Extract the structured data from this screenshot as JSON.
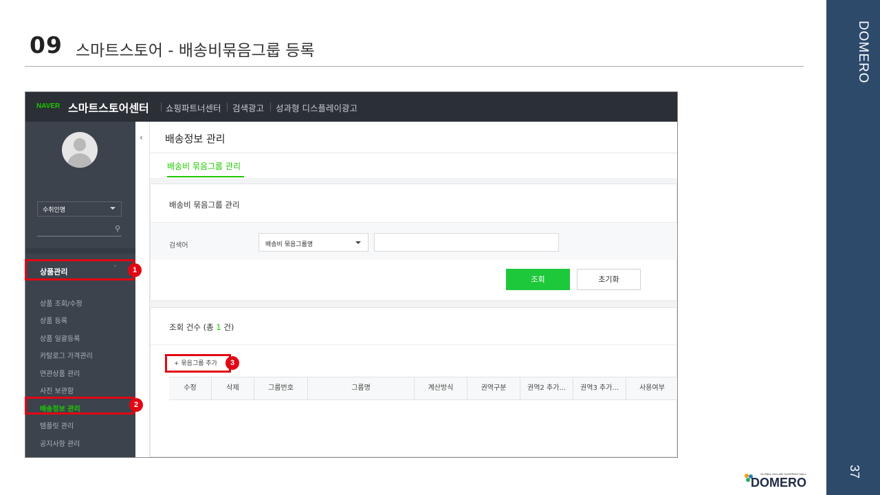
{
  "slide": {
    "number": "09",
    "title": "스마트스토어 - 배송비묶음그룹 등록",
    "brand_vertical": "DOMERO",
    "page_number": "37",
    "logo_small": "GLOBAL ON-LINE SHOPPING MALL",
    "logo_text": "DOMERO"
  },
  "app": {
    "naver": "NAVER",
    "center_name": "스마트스토어센터",
    "top_nav": [
      "쇼핑파트너센터",
      "검색광고",
      "성과형 디스플레이광고"
    ]
  },
  "sidebar": {
    "seller_select": "수취인명",
    "group_label": "상품관리",
    "items": [
      {
        "label": "상품 조회/수정"
      },
      {
        "label": "상품 등록"
      },
      {
        "label": "상품 일괄등록"
      },
      {
        "label": "카탈로그 가격관리"
      },
      {
        "label": "연관상품 관리"
      },
      {
        "label": "사진 보관함"
      },
      {
        "label": "배송정보 관리"
      },
      {
        "label": "템플릿 관리"
      },
      {
        "label": "공지사항 관리"
      }
    ]
  },
  "main": {
    "page_title": "배송정보 관리",
    "tab": "배송비 묶음그룹 관리",
    "panel_title": "배송비 묶음그룹 관리",
    "search_label": "검색어",
    "search_type": "배송비 묶음그룹명",
    "search_value": "",
    "search_button": "조회",
    "reset_button": "초기화",
    "count_prefix": "조회 건수 (총 ",
    "count_value": "1",
    "count_suffix": " 건)",
    "add_group": "+ 묶음그룹 추가",
    "columns": [
      "수정",
      "삭제",
      "그룹번호",
      "그룹명",
      "계산방식",
      "권역구분",
      "권역2 추가...",
      "권역3 추가...",
      "사용여부"
    ]
  },
  "annotations": [
    "1",
    "2",
    "3"
  ],
  "colors": {
    "accent_green": "#1ec800",
    "annotation_red": "#e30613",
    "band_blue": "#2d4a6b"
  }
}
